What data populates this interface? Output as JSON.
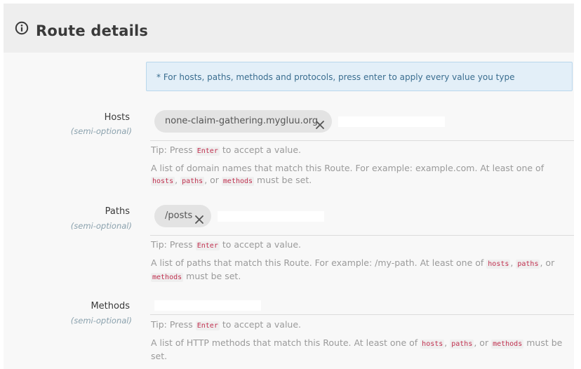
{
  "header": {
    "title": "Route details",
    "icon": "info-circle-icon"
  },
  "notice": {
    "text": "* For hosts, paths, methods and protocols, press enter to apply every value you type"
  },
  "tip": {
    "prefix": "Tip: Press",
    "key": "Enter",
    "suffix": "to accept a value."
  },
  "fields": {
    "hosts": {
      "label": "Hosts",
      "sublabel": "(semi-optional)",
      "chips": [
        "none-claim-gathering.mygluu.org"
      ],
      "input_value": "",
      "desc_text": "A list of domain names that match this Route. For example: example.com. At least one of",
      "desc_code1": "hosts",
      "desc_code2": "paths",
      "desc_code3": "methods",
      "desc_sep1": ",",
      "desc_sep2": ", or",
      "desc_end": "must be set."
    },
    "paths": {
      "label": "Paths",
      "sublabel": "(semi-optional)",
      "chips": [
        "/posts"
      ],
      "input_value": "",
      "desc_text": "A list of paths that match this Route. For example: /my-path. At least one of",
      "desc_code1": "hosts",
      "desc_code2": "paths",
      "desc_code3": "methods",
      "desc_sep1": ",",
      "desc_sep2": ", or",
      "desc_end": "must be set."
    },
    "methods": {
      "label": "Methods",
      "sublabel": "(semi-optional)",
      "chips": [],
      "input_value": "",
      "desc_text": "A list of HTTP methods that match this Route. At least one of",
      "desc_code1": "hosts",
      "desc_code2": "paths",
      "desc_code3": "methods",
      "desc_sep1": ",",
      "desc_sep2": ", or",
      "desc_end": "must be set."
    }
  },
  "colors": {
    "header_bg": "#eeeeee",
    "notice_bg": "#e3eff8",
    "notice_text": "#3a6d8f",
    "code_text": "#c0304f",
    "chip_bg": "#e3e3e3"
  }
}
